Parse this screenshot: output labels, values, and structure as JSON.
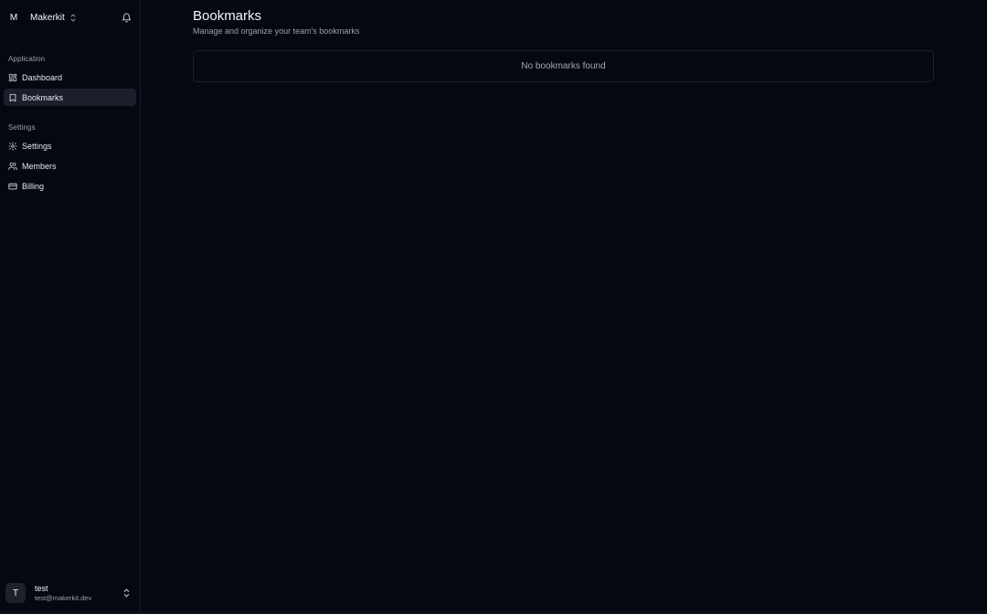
{
  "team": {
    "avatar_letter": "M",
    "name": "Makerkit"
  },
  "sidebar": {
    "sections": [
      {
        "label": "Application",
        "items": [
          {
            "label": "Dashboard",
            "icon": "grid-icon",
            "active": false
          },
          {
            "label": "Bookmarks",
            "icon": "bookmark-icon",
            "active": true
          }
        ]
      },
      {
        "label": "Settings",
        "items": [
          {
            "label": "Settings",
            "icon": "gear-icon",
            "active": false
          },
          {
            "label": "Members",
            "icon": "users-icon",
            "active": false
          },
          {
            "label": "Billing",
            "icon": "credit-card-icon",
            "active": false
          }
        ]
      }
    ]
  },
  "user": {
    "avatar_letter": "T",
    "name": "test",
    "email": "test@makerkit.dev"
  },
  "main": {
    "title": "Bookmarks",
    "subtitle": "Manage and organize your team's bookmarks",
    "empty_message": "No bookmarks found"
  },
  "colors": {
    "background": "#050811",
    "active_item": "#1a1f2b",
    "muted_text": "#9aa0ab"
  }
}
